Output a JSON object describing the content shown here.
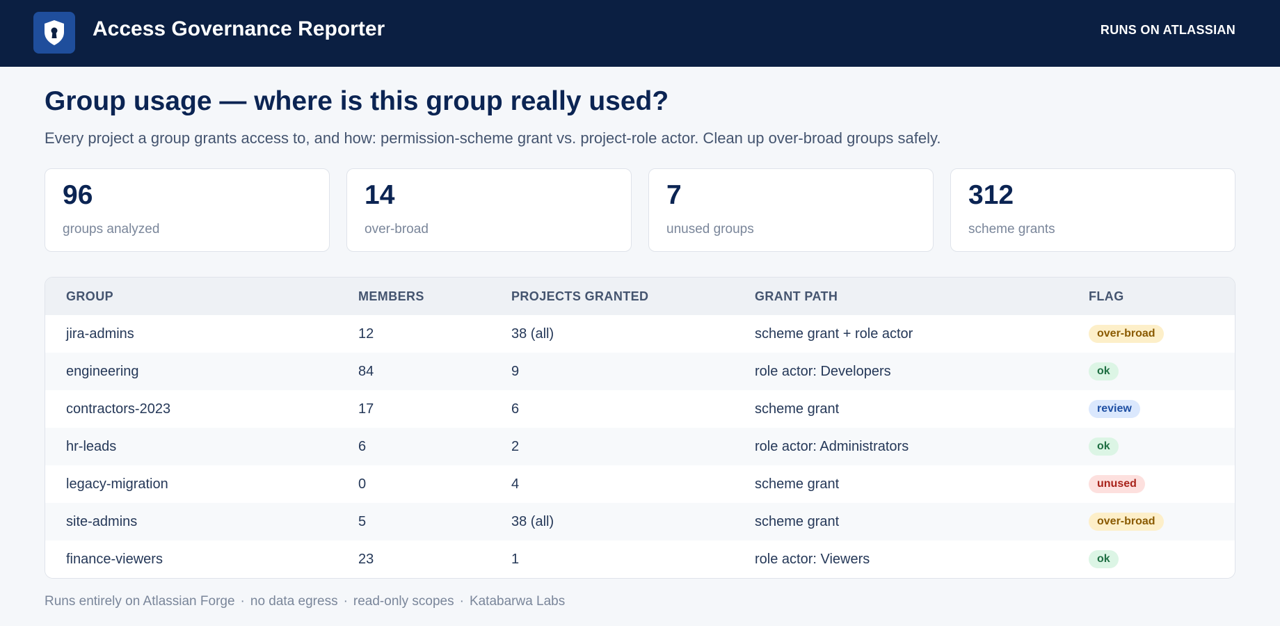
{
  "header": {
    "app_title": "Access Governance Reporter",
    "runs_on": "RUNS ON ATLASSIAN",
    "logo_icon": "shield-keyhole-icon"
  },
  "page": {
    "title": "Group usage — where is this group really used?",
    "subtitle": "Every project a group grants access to, and how: permission-scheme grant vs. project-role actor. Clean up over-broad groups safely."
  },
  "stats": [
    {
      "value": "96",
      "label": "groups analyzed"
    },
    {
      "value": "14",
      "label": "over-broad"
    },
    {
      "value": "7",
      "label": "unused groups"
    },
    {
      "value": "312",
      "label": "scheme grants"
    }
  ],
  "table": {
    "columns": [
      "GROUP",
      "MEMBERS",
      "PROJECTS GRANTED",
      "GRANT PATH",
      "FLAG"
    ],
    "rows": [
      {
        "group": "jira-admins",
        "members": "12",
        "projects": "38 (all)",
        "path": "scheme grant + role actor",
        "flag": "over-broad"
      },
      {
        "group": "engineering",
        "members": "84",
        "projects": "9",
        "path": "role actor: Developers",
        "flag": "ok"
      },
      {
        "group": "contractors-2023",
        "members": "17",
        "projects": "6",
        "path": "scheme grant",
        "flag": "review"
      },
      {
        "group": "hr-leads",
        "members": "6",
        "projects": "2",
        "path": "role actor: Administrators",
        "flag": "ok"
      },
      {
        "group": "legacy-migration",
        "members": "0",
        "projects": "4",
        "path": "scheme grant",
        "flag": "unused"
      },
      {
        "group": "site-admins",
        "members": "5",
        "projects": "38 (all)",
        "path": "scheme grant",
        "flag": "over-broad"
      },
      {
        "group": "finance-viewers",
        "members": "23",
        "projects": "1",
        "path": "role actor: Viewers",
        "flag": "ok"
      }
    ]
  },
  "flag_colors": {
    "over-broad": {
      "bg": "#fdefc9",
      "fg": "#8a5a00"
    },
    "ok": {
      "bg": "#dcf5e5",
      "fg": "#1f6f43"
    },
    "review": {
      "bg": "#dbe8fd",
      "fg": "#1e4fa3"
    },
    "unused": {
      "bg": "#fde0de",
      "fg": "#a8231b"
    }
  },
  "footer": {
    "items": [
      "Runs entirely on Atlassian Forge",
      "no data egress",
      "read-only scopes",
      "Katabarwa Labs"
    ],
    "separator": "·"
  },
  "colors": {
    "topbar": "#0b1f42",
    "accent": "#1f4e9c",
    "title": "#0b2453"
  }
}
